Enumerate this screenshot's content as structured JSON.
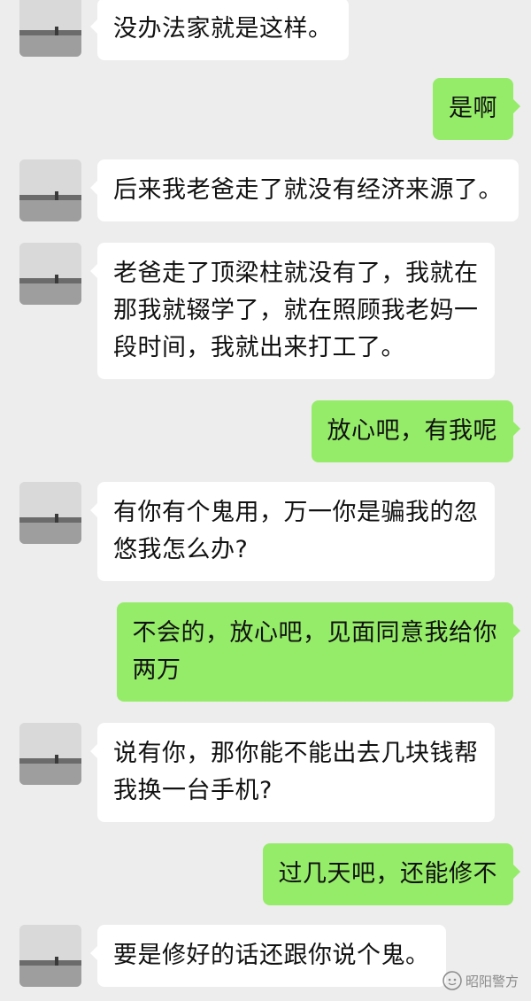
{
  "messages": [
    {
      "side": "in",
      "text": "没办法家就是这样。"
    },
    {
      "side": "out",
      "text": "是啊"
    },
    {
      "side": "in",
      "text": "后来我老爸走了就没有经济来源了。"
    },
    {
      "side": "in",
      "text": "老爸走了顶梁柱就没有了，我就在\n那我就辍学了，就在照顾我老妈一\n段时间，我就出来打工了。"
    },
    {
      "side": "out",
      "text": "放心吧，有我呢"
    },
    {
      "side": "in",
      "text": "有你有个鬼用，万一你是骗我的忽\n悠我怎么办?"
    },
    {
      "side": "out",
      "text": "不会的，放心吧，见面同意我给你\n两万"
    },
    {
      "side": "in",
      "text": "说有你，那你能不能出去几块钱帮\n我换一台手机?"
    },
    {
      "side": "out",
      "text": "过几天吧，还能修不"
    },
    {
      "side": "in",
      "text": "要是修好的话还跟你说个鬼。"
    }
  ],
  "watermark": {
    "label": "昭阳警方",
    "icon": "wechat-channel-icon"
  },
  "colors": {
    "background": "#ededed",
    "incoming_bubble": "#ffffff",
    "outgoing_bubble": "#95ec69"
  }
}
